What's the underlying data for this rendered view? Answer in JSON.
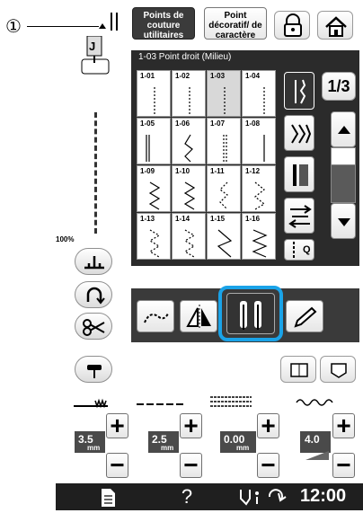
{
  "callout": {
    "number": "①"
  },
  "tabs": {
    "utility": "Points de couture utilitaires",
    "decorative": "Point décoratif/ de caractère"
  },
  "panel": {
    "header": "1-03  Point droit (Milieu)",
    "page_indicator": "1/3",
    "stitches": [
      "1-01",
      "1-02",
      "1-03",
      "1-04",
      "1-05",
      "1-06",
      "1-07",
      "1-08",
      "1-09",
      "1-10",
      "1-11",
      "1-12",
      "1-13",
      "1-14",
      "1-15",
      "1-16"
    ],
    "selected": "1-03",
    "q_label": "Q"
  },
  "left": {
    "speed_label": "100%"
  },
  "settings": {
    "width": {
      "value": "3.5",
      "unit": "mm"
    },
    "length": {
      "value": "2.5",
      "unit": "mm"
    },
    "offset": {
      "value": "0.00",
      "unit": "mm"
    },
    "tension": {
      "value": "4.0"
    }
  },
  "footer": {
    "help": "?",
    "clock": "12:00"
  }
}
